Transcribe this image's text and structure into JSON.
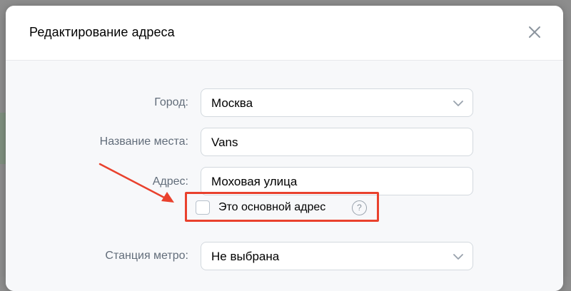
{
  "modal": {
    "title": "Редактирование адреса"
  },
  "form": {
    "city": {
      "label": "Город:",
      "value": "Москва"
    },
    "place_name": {
      "label": "Название места:",
      "value": "Vans"
    },
    "address": {
      "label": "Адрес:",
      "value": "Моховая улица"
    },
    "primary_address": {
      "label": "Это основной адрес",
      "checked": false,
      "help": "?"
    },
    "metro": {
      "label": "Станция метро:",
      "value": "Не выбрана"
    }
  },
  "colors": {
    "highlight": "#e9412d",
    "label_text": "#626d7a",
    "field_border": "#d3d9de"
  }
}
